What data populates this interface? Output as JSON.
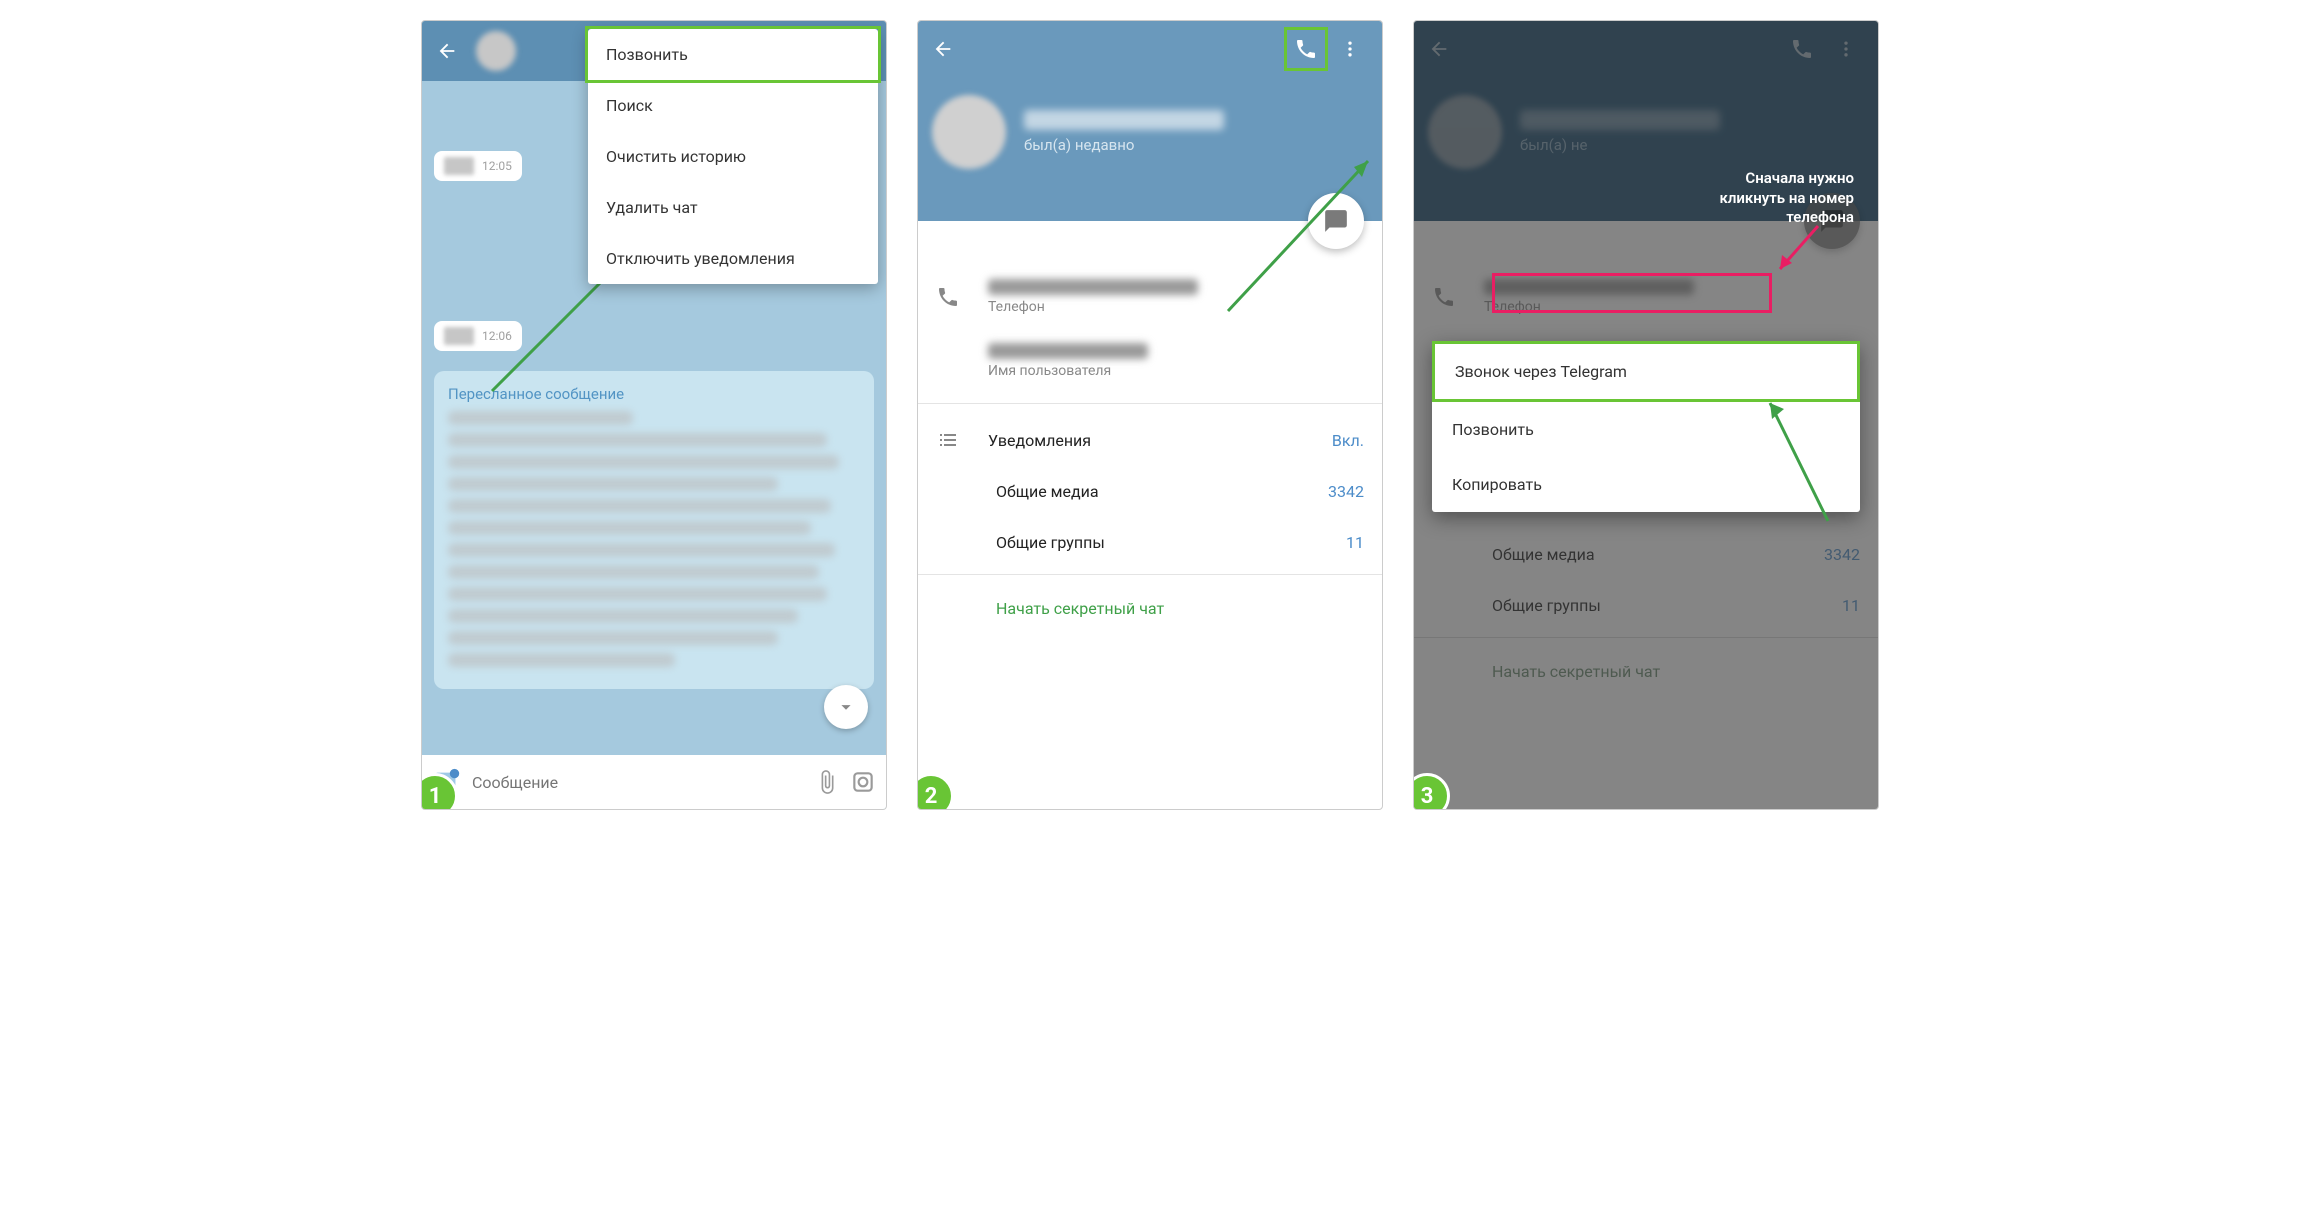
{
  "screen1": {
    "menu": {
      "call": "Позвонить",
      "search": "Поиск",
      "clear": "Очистить историю",
      "delete": "Удалить чат",
      "mute": "Отключить уведомления"
    },
    "time1": "12:05",
    "time2": "12:06",
    "forwarded_label": "Пересланное сообщение",
    "input_placeholder": "Сообщение"
  },
  "screen2": {
    "status": "был(а) недавно",
    "phone_label": "Телефон",
    "username_label": "Имя пользователя",
    "notifications_label": "Уведомления",
    "notifications_value": "Вкл.",
    "media_label": "Общие медиа",
    "media_value": "3342",
    "groups_label": "Общие группы",
    "groups_value": "11",
    "secret_chat": "Начать секретный чат"
  },
  "screen3": {
    "status": "был(а) не",
    "annotation": "Сначала нужно\nкликнуть на номер\nтелефона",
    "phone_label": "Телефон",
    "context_menu": {
      "telegram_call": "Звонок через Telegram",
      "call": "Позвонить",
      "copy": "Копировать"
    },
    "media_label": "Общие медиа",
    "media_value": "3342",
    "groups_label": "Общие группы",
    "groups_value": "11",
    "secret_chat": "Начать секретный чат"
  },
  "badges": {
    "b1": "1",
    "b2": "2",
    "b3": "3"
  }
}
